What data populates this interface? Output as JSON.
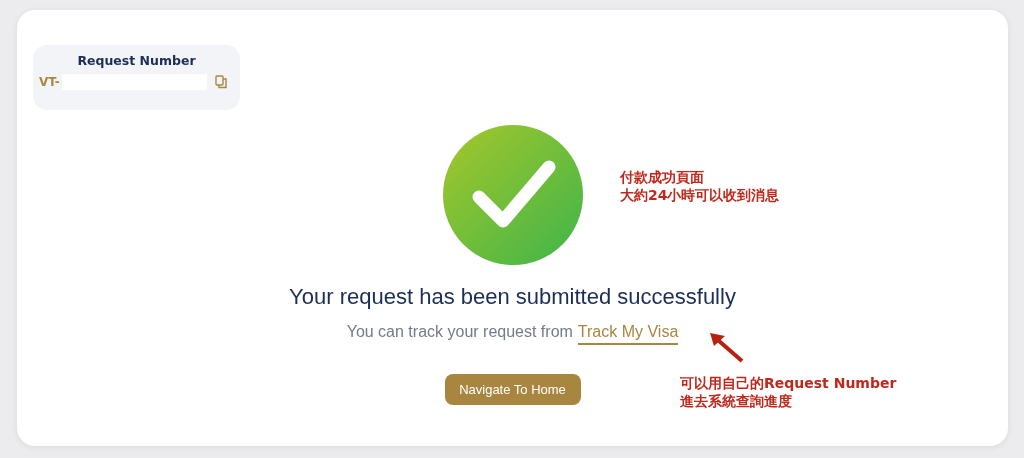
{
  "request_number": {
    "title": "Request Number",
    "prefix": "VT-"
  },
  "message": {
    "title": "Your request has been submitted successfully",
    "text": "You can track your request from",
    "link": "Track My Visa"
  },
  "button": "Navigate To Home",
  "annotations": [
    {
      "lines": [
        "付款成功頁面",
        "大約24小時可以收到消息"
      ]
    },
    {
      "lines": [
        "可以用自己的Request Number",
        "進去系統查詢進度"
      ]
    }
  ]
}
